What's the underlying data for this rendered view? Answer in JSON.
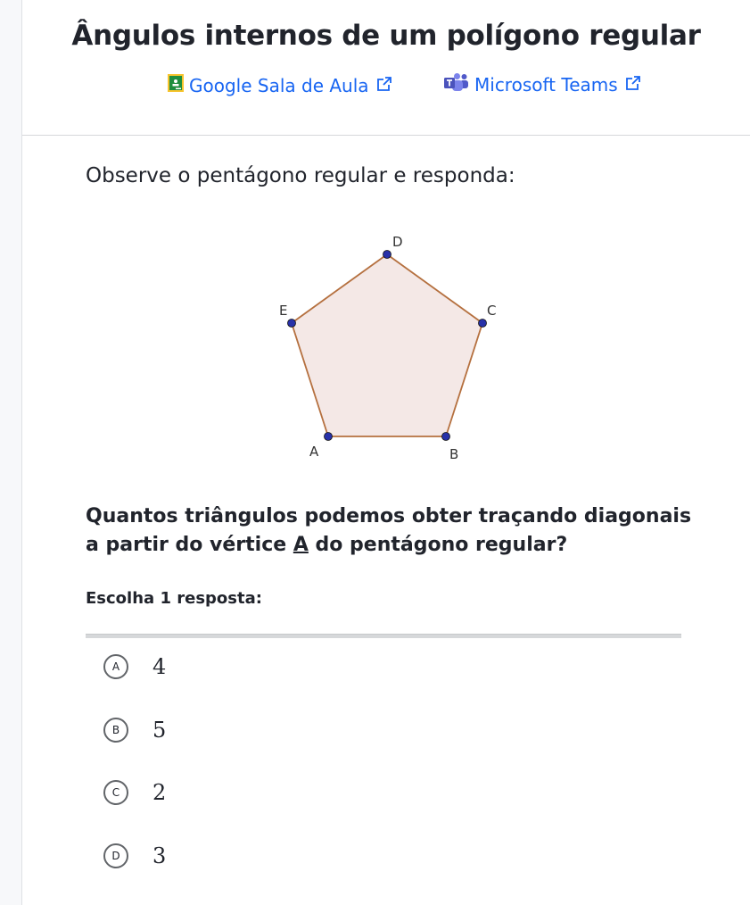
{
  "header": {
    "title": "Ângulos internos de um polígono regular",
    "links": [
      {
        "label": "Google Sala de Aula",
        "icon": "google-classroom-icon"
      },
      {
        "label": "Microsoft Teams",
        "icon": "microsoft-teams-icon"
      }
    ],
    "external_icon": "external-link-icon"
  },
  "exercise": {
    "prompt": "Observe o pentágono regular e responda:",
    "figure": {
      "vertices": [
        "A",
        "B",
        "C",
        "D",
        "E"
      ],
      "fill_color": "#f4e8e6",
      "stroke_color": "#b5703f",
      "point_color": "#2831a8"
    },
    "question_start": "Quantos triângulos podemos obter traçando diagonais a partir do vértice ",
    "question_vertex": "A",
    "question_end": " do pentágono regular?",
    "instruction": "Escolha 1 resposta:",
    "choices": [
      {
        "letter": "A",
        "value": "4"
      },
      {
        "letter": "B",
        "value": "5"
      },
      {
        "letter": "C",
        "value": "2"
      },
      {
        "letter": "D",
        "value": "3"
      }
    ]
  },
  "colors": {
    "link": "#1865f2",
    "text": "#21242c",
    "divider": "#d6d8da"
  }
}
